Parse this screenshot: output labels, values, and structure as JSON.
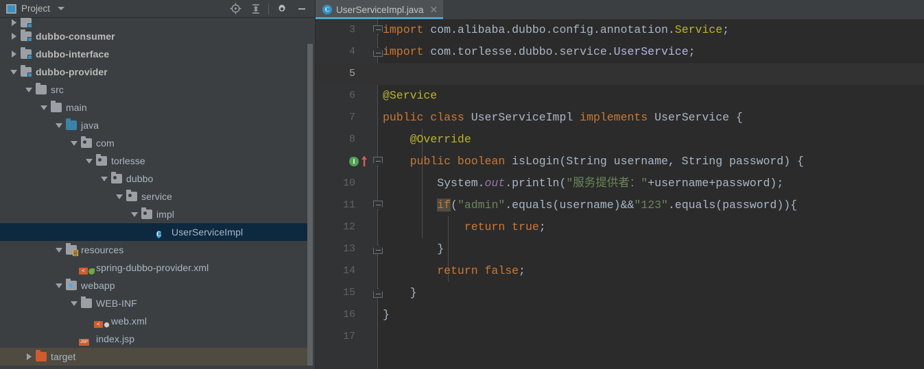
{
  "window": {
    "background": "#3c3f41",
    "editor_background": "#2b2b2b"
  },
  "sidebar": {
    "title": "Project",
    "title_icon": "project-view-icon",
    "dropdown_icon": "chevron-down-icon",
    "toolbar": [
      {
        "name": "locate-target-icon",
        "label": "Select Opened File"
      },
      {
        "name": "collapse-all-icon",
        "label": "Collapse All"
      },
      {
        "name": "gear-icon",
        "label": "Settings"
      },
      {
        "name": "minimize-icon",
        "label": "Hide"
      }
    ],
    "tree": [
      {
        "label": "",
        "indent": 0,
        "arrow": "right",
        "icon": "module-folder-icon",
        "state": "partial",
        "bold": true
      },
      {
        "label": "dubbo-consumer",
        "indent": 0,
        "arrow": "right",
        "icon": "module-folder-icon",
        "state": "normal",
        "bold": true
      },
      {
        "label": "dubbo-interface",
        "indent": 0,
        "arrow": "right",
        "icon": "module-folder-icon",
        "state": "normal",
        "bold": true
      },
      {
        "label": "dubbo-provider",
        "indent": 0,
        "arrow": "down",
        "icon": "module-folder-icon",
        "state": "normal",
        "bold": true
      },
      {
        "label": "src",
        "indent": 1,
        "arrow": "down",
        "icon": "folder-icon",
        "state": "normal",
        "bold": false
      },
      {
        "label": "main",
        "indent": 2,
        "arrow": "down",
        "icon": "folder-icon",
        "state": "normal",
        "bold": false
      },
      {
        "label": "java",
        "indent": 3,
        "arrow": "down",
        "icon": "source-root-icon",
        "state": "normal",
        "bold": false
      },
      {
        "label": "com",
        "indent": 4,
        "arrow": "down",
        "icon": "package-icon",
        "state": "normal",
        "bold": false
      },
      {
        "label": "torlesse",
        "indent": 5,
        "arrow": "down",
        "icon": "package-icon",
        "state": "normal",
        "bold": false
      },
      {
        "label": "dubbo",
        "indent": 6,
        "arrow": "down",
        "icon": "package-icon",
        "state": "normal",
        "bold": false
      },
      {
        "label": "service",
        "indent": 7,
        "arrow": "down",
        "icon": "package-icon",
        "state": "normal",
        "bold": false
      },
      {
        "label": "impl",
        "indent": 8,
        "arrow": "down",
        "icon": "package-icon",
        "state": "normal",
        "bold": false
      },
      {
        "label": "UserServiceImpl",
        "indent": 9,
        "arrow": "none",
        "icon": "java-class-icon",
        "state": "selected",
        "bold": false
      },
      {
        "label": "resources",
        "indent": 3,
        "arrow": "down",
        "icon": "resource-root-icon",
        "state": "normal",
        "bold": false
      },
      {
        "label": "spring-dubbo-provider.xml",
        "indent": 4,
        "arrow": "none",
        "icon": "spring-xml-icon",
        "state": "normal",
        "bold": false
      },
      {
        "label": "webapp",
        "indent": 3,
        "arrow": "down",
        "icon": "web-root-icon",
        "state": "normal",
        "bold": false
      },
      {
        "label": "WEB-INF",
        "indent": 4,
        "arrow": "down",
        "icon": "folder-icon",
        "state": "normal",
        "bold": false
      },
      {
        "label": "web.xml",
        "indent": 5,
        "arrow": "none",
        "icon": "web-xml-icon",
        "state": "normal",
        "bold": false
      },
      {
        "label": "index.jsp",
        "indent": 4,
        "arrow": "none",
        "icon": "jsp-file-icon",
        "state": "normal",
        "bold": false
      },
      {
        "label": "target",
        "indent": 1,
        "arrow": "right",
        "icon": "excluded-folder-icon",
        "state": "hovered",
        "bold": false
      }
    ],
    "selected_row_color": "#0d293f",
    "hovered_row_color": "#4f4b41"
  },
  "editor": {
    "tabs": [
      {
        "label": "UserServiceImpl.java",
        "icon": "java-class-icon",
        "close_icon": "close-icon",
        "active": true
      }
    ],
    "accent_color": "#4ba6c9",
    "caret_line": 5,
    "gutter_markers": [
      {
        "line": 9,
        "name": "implementing-method-icon",
        "glyph": "I",
        "color": "#51a34f"
      },
      {
        "line": 9,
        "name": "override-arrow-icon",
        "color": "#d05b5b"
      }
    ],
    "lines": [
      {
        "n": 3,
        "fold": "open",
        "tokens": [
          {
            "t": "import",
            "c": "kw"
          },
          {
            "t": " com.alibaba.dubbo.config.annotation.",
            "c": "cls"
          },
          {
            "t": "Service",
            "c": "ann"
          },
          {
            "t": ";",
            "c": "cls"
          }
        ]
      },
      {
        "n": 4,
        "fold": "end",
        "tokens": [
          {
            "t": "import",
            "c": "kw"
          },
          {
            "t": " com.torlesse.dubbo.service.",
            "c": "cls"
          },
          {
            "t": "UserService",
            "c": "typ"
          },
          {
            "t": ";",
            "c": "cls"
          }
        ]
      },
      {
        "n": 5,
        "fold": "none",
        "tokens": []
      },
      {
        "n": 6,
        "fold": "none",
        "tokens": [
          {
            "t": "@Service",
            "c": "ann"
          }
        ]
      },
      {
        "n": 7,
        "fold": "none",
        "tokens": [
          {
            "t": "public class ",
            "c": "kw"
          },
          {
            "t": "UserServiceImpl",
            "c": "cls"
          },
          {
            "t": " implements ",
            "c": "kw"
          },
          {
            "t": "UserService",
            "c": "cls"
          },
          {
            "t": " {",
            "c": "cls"
          }
        ]
      },
      {
        "n": 8,
        "fold": "none",
        "tokens": [
          {
            "t": "    ",
            "c": "cls"
          },
          {
            "t": "@Override",
            "c": "ann"
          }
        ]
      },
      {
        "n": 9,
        "fold": "open",
        "tokens": [
          {
            "t": "    ",
            "c": "cls"
          },
          {
            "t": "public boolean ",
            "c": "kw"
          },
          {
            "t": "isLogin",
            "c": "mth"
          },
          {
            "t": "(String username, String password) {",
            "c": "cls"
          }
        ]
      },
      {
        "n": 10,
        "fold": "none",
        "tokens": [
          {
            "t": "        System.",
            "c": "cls"
          },
          {
            "t": "out",
            "c": "fld"
          },
          {
            "t": ".println(",
            "c": "cls"
          },
          {
            "t": "\"服务提供者：\"",
            "c": "str"
          },
          {
            "t": "+username+password);",
            "c": "cls"
          }
        ]
      },
      {
        "n": 11,
        "fold": "open",
        "tokens": [
          {
            "t": "        ",
            "c": "cls"
          },
          {
            "t": "if",
            "c": "kw hl"
          },
          {
            "t": "(",
            "c": "cls"
          },
          {
            "t": "\"admin\"",
            "c": "str"
          },
          {
            "t": ".equals(username)&&",
            "c": "cls"
          },
          {
            "t": "\"123\"",
            "c": "str"
          },
          {
            "t": ".equals(password)){",
            "c": "cls"
          }
        ]
      },
      {
        "n": 12,
        "fold": "none",
        "tokens": [
          {
            "t": "            ",
            "c": "cls"
          },
          {
            "t": "return true",
            "c": "kw"
          },
          {
            "t": ";",
            "c": "cls"
          }
        ]
      },
      {
        "n": 13,
        "fold": "end",
        "tokens": [
          {
            "t": "        }",
            "c": "cls"
          }
        ]
      },
      {
        "n": 14,
        "fold": "none",
        "tokens": [
          {
            "t": "        ",
            "c": "cls"
          },
          {
            "t": "return false",
            "c": "kw"
          },
          {
            "t": ";",
            "c": "cls"
          }
        ]
      },
      {
        "n": 15,
        "fold": "end",
        "tokens": [
          {
            "t": "    }",
            "c": "cls"
          }
        ]
      },
      {
        "n": 16,
        "fold": "none",
        "tokens": [
          {
            "t": "}",
            "c": "cls"
          }
        ]
      },
      {
        "n": 17,
        "fold": "none",
        "tokens": []
      }
    ],
    "syntax_colors": {
      "keyword": "#cc7832",
      "annotation": "#bbb529",
      "string": "#6a8759",
      "identifier": "#a9b7c6",
      "class_ref": "#b5b6e3",
      "static_field": "#9876aa",
      "line_number": "#606366",
      "highlight": "#4f4b41"
    }
  }
}
